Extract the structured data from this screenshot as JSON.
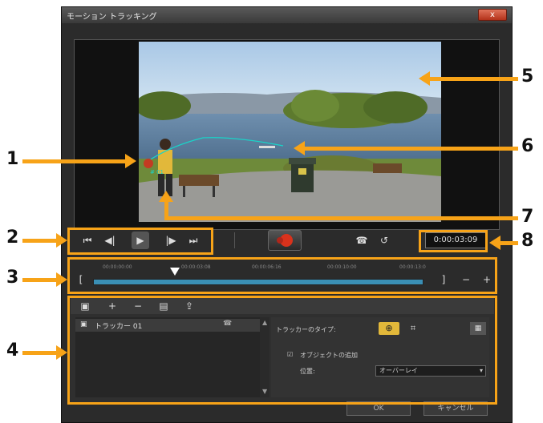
{
  "window": {
    "title": "モーション トラッキング",
    "close_glyph": "x"
  },
  "controls": {
    "timecode": "0:00:03:09",
    "icons": [
      "go-to-start-icon",
      "prev-frame-icon",
      "play-icon",
      "next-frame-icon",
      "go-to-end-icon",
      "motion-track-record-icon",
      "tracker-path-icon",
      "reset-icon"
    ]
  },
  "timeline": {
    "ticks": [
      "00:00:00:00",
      "00:00:03:08",
      "00:00:06:16",
      "00:00:10:00",
      "00:00:13:0"
    ]
  },
  "tracker_panel": {
    "tracker_name": "トラッカー 01",
    "tracker_type_label": "トラッカーのタイプ:",
    "add_object_label": "オブジェクトの追加",
    "position_label": "位置:",
    "position_value": "オーバーレイ",
    "add_object_checked": true
  },
  "buttons": {
    "ok": "OK",
    "cancel": "キャンセル"
  },
  "preview": {
    "tracker_tag": "# 01"
  },
  "annotations": [
    "1",
    "2",
    "3",
    "4",
    "5",
    "6",
    "7",
    "8"
  ],
  "colors": {
    "callout": "#f7a318",
    "track_path": "#19d4c8",
    "track_bar": "#3a8fb5"
  }
}
